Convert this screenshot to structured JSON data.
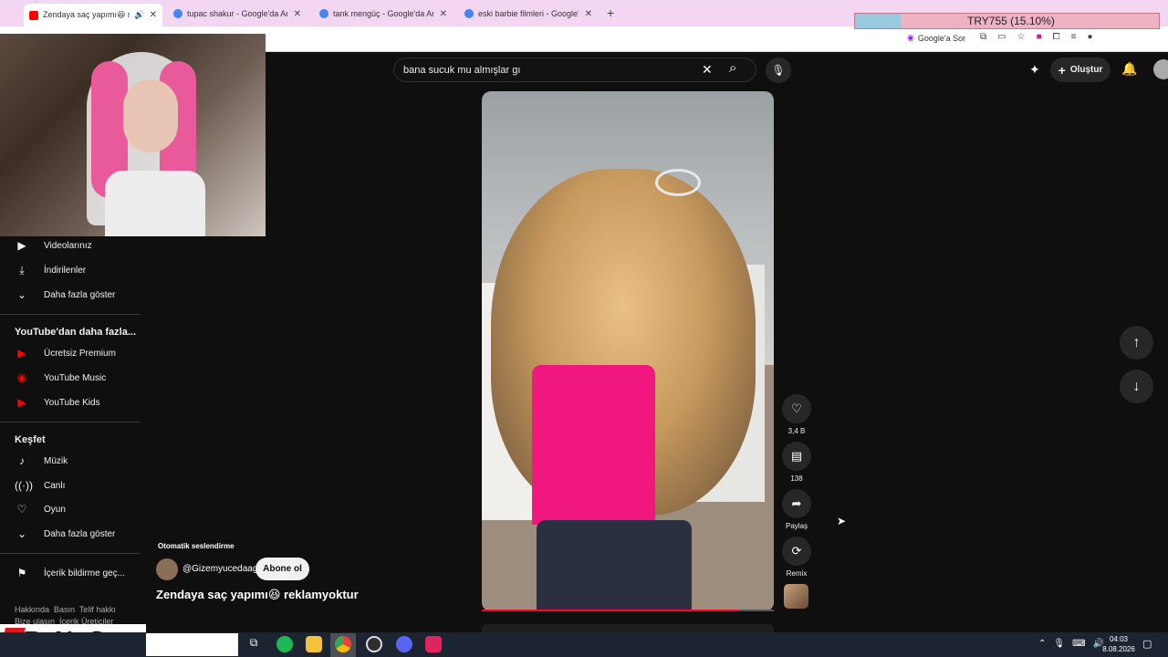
{
  "browser": {
    "tabs": [
      {
        "title": "Zendaya saç yapımı😆 rekl"
      },
      {
        "title": "tupac shakur - Google'da Ara"
      },
      {
        "title": "tank mengüç - Google'da Ara"
      },
      {
        "title": "eski barbie filmleri - Google'da"
      }
    ],
    "new_tab": "+",
    "google_ask": "Google'a Sor"
  },
  "overlay": {
    "try_label": "TRY755 (15.10%)",
    "try_progress": 0.151
  },
  "youtube": {
    "search_value": "bana sucuk mu almışlar gı",
    "create_label": "Oluştur",
    "sidebar": {
      "you_items": [
        {
          "label": "Videolarınız",
          "icon": "play-icon"
        },
        {
          "label": "İndirilenler",
          "icon": "download-icon"
        },
        {
          "label": "Daha fazla göster",
          "icon": "chevron-down-icon"
        }
      ],
      "more_header": "YouTube'dan daha fazla...",
      "more_items": [
        {
          "label": "Ücretsiz Premium",
          "icon": "youtube-icon"
        },
        {
          "label": "YouTube Music",
          "icon": "youtube-music-icon"
        },
        {
          "label": "YouTube Kids",
          "icon": "youtube-kids-icon"
        }
      ],
      "explore_header": "Keşfet",
      "explore_items": [
        {
          "label": "Müzik",
          "icon": "music-icon"
        },
        {
          "label": "Canlı",
          "icon": "live-icon"
        },
        {
          "label": "Oyun",
          "icon": "game-icon"
        },
        {
          "label": "Daha fazla göster",
          "icon": "chevron-down-icon"
        }
      ],
      "report_label": "İçerik bildirme geç...",
      "footer_line1": "Hakkında  Basın  Telif hakkı",
      "footer_line2": "Bize ulaşın  İçerik Üreticiler"
    },
    "short": {
      "auto_dub": "Otomatik seslendirme",
      "channel": "@Gizemyucedaag",
      "subscribe": "Abone ol",
      "title": "Zendaya saç yapımı😆 reklamyoktur",
      "progress": 0.88
    },
    "actions": {
      "likes": "3,4 B",
      "comments": "138",
      "share": "Paylaş",
      "remix": "Remix"
    }
  },
  "watermark": "ByNoGame",
  "taskbar": {
    "time": "04:03",
    "date": "8.08.2026"
  }
}
